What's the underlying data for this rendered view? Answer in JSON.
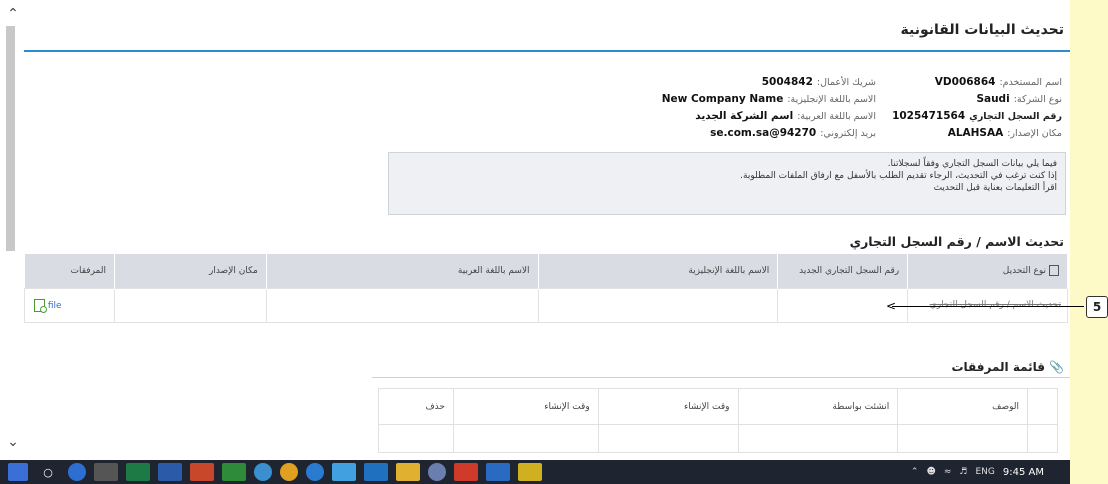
{
  "page": {
    "title": "تحديث البيانات القانونية",
    "section_title": "تحديث الاسم / رقم السجل التجاري",
    "attachments_title": "قائمة المرفقات"
  },
  "info_right": [
    {
      "label": "اسم المستخدم:",
      "value": "VD006864"
    },
    {
      "label": "نوع الشركة:",
      "value": "Saudi"
    },
    {
      "label": "رقم السجل التجاري",
      "value": "1025471564"
    },
    {
      "label": "مكان الإصدار:",
      "value": "ALAHSAA"
    }
  ],
  "info_left": [
    {
      "label": "شريك الأعمال:",
      "value": "5004842"
    },
    {
      "label": "الاسم باللغة الإنجليزية:",
      "value": "New Company Name"
    },
    {
      "label": "الاسم باللغة العربية:",
      "value": "اسم الشركة الجديد"
    },
    {
      "label": "بريد إلكتروني:",
      "value": "se.com.sa@94270"
    }
  ],
  "notice": [
    "فيما يلي بيانات السجل التجاري وفقاً لسجلاتنا.",
    "إذا كنت ترغب في التحديث، الرجاء تقديم الطلب بالأسفل مع ارفاق الملفات المطلوبة.",
    "اقرأ التعليمات بعناية قبل التحديث"
  ],
  "update_table": {
    "headers": [
      "نوع التحديل",
      "رقم السجل التجاري الجديد",
      "الاسم باللغة الإنجليزية",
      "الاسم باللغة العربية",
      "مكان الإصدار",
      "المرفقات"
    ],
    "row": {
      "type": "تحديث الاسم / رقم السجل التجاري",
      "attachment_link": "file"
    }
  },
  "callout": {
    "number": "5"
  },
  "attachments_table": {
    "headers": [
      "الوصف",
      "انشئت بواسطة",
      "وقت الإنشاء",
      "وقت الإنشاء",
      "حذف"
    ]
  },
  "taskbar": {
    "items": [
      "search-icon",
      "cortana-icon",
      "calculator-icon",
      "excel-icon",
      "word-icon",
      "powerpoint-icon",
      "project-icon",
      "sap-icon",
      "chrome-icon",
      "edge-icon",
      "ie-icon",
      "outlook-icon",
      "explorer-icon",
      "media-icon",
      "acrobat-icon",
      "paint-icon",
      "app-icon"
    ],
    "lang": "ENG",
    "time": "9:45 AM"
  }
}
